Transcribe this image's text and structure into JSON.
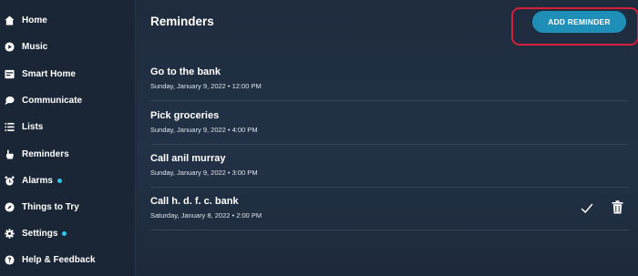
{
  "sidebar": {
    "items": [
      {
        "label": "Home",
        "icon": "home-icon",
        "dot": false
      },
      {
        "label": "Music",
        "icon": "play-icon",
        "dot": false
      },
      {
        "label": "Smart Home",
        "icon": "smart-home-icon",
        "dot": false
      },
      {
        "label": "Communicate",
        "icon": "chat-icon",
        "dot": false
      },
      {
        "label": "Lists",
        "icon": "list-icon",
        "dot": false
      },
      {
        "label": "Reminders",
        "icon": "reminder-hand-icon",
        "dot": false
      },
      {
        "label": "Alarms",
        "icon": "alarm-clock-icon",
        "dot": true
      },
      {
        "label": "Things to Try",
        "icon": "compass-icon",
        "dot": false
      },
      {
        "label": "Settings",
        "icon": "gear-icon",
        "dot": true
      },
      {
        "label": "Help & Feedback",
        "icon": "help-icon",
        "dot": false
      }
    ]
  },
  "header": {
    "title": "Reminders",
    "add_button_label": "ADD REMINDER"
  },
  "reminders": [
    {
      "title": "Go to the bank",
      "time": "Sunday, January 9, 2022 • 12:00 PM",
      "actions": false
    },
    {
      "title": "Pick groceries",
      "time": "Sunday, January 9, 2022 • 4:00 PM",
      "actions": false
    },
    {
      "title": "Call anil murray",
      "time": "Sunday, January 9, 2022 • 3:00 PM",
      "actions": false
    },
    {
      "title": "Call h. d. f. c. bank",
      "time": "Saturday, January 8, 2022 • 2:00 PM",
      "actions": true
    }
  ],
  "colors": {
    "accent": "#1f8fb8",
    "notification_dot": "#2ec5ea",
    "highlight_border": "#d4203a",
    "background": "#1f2c3d"
  }
}
